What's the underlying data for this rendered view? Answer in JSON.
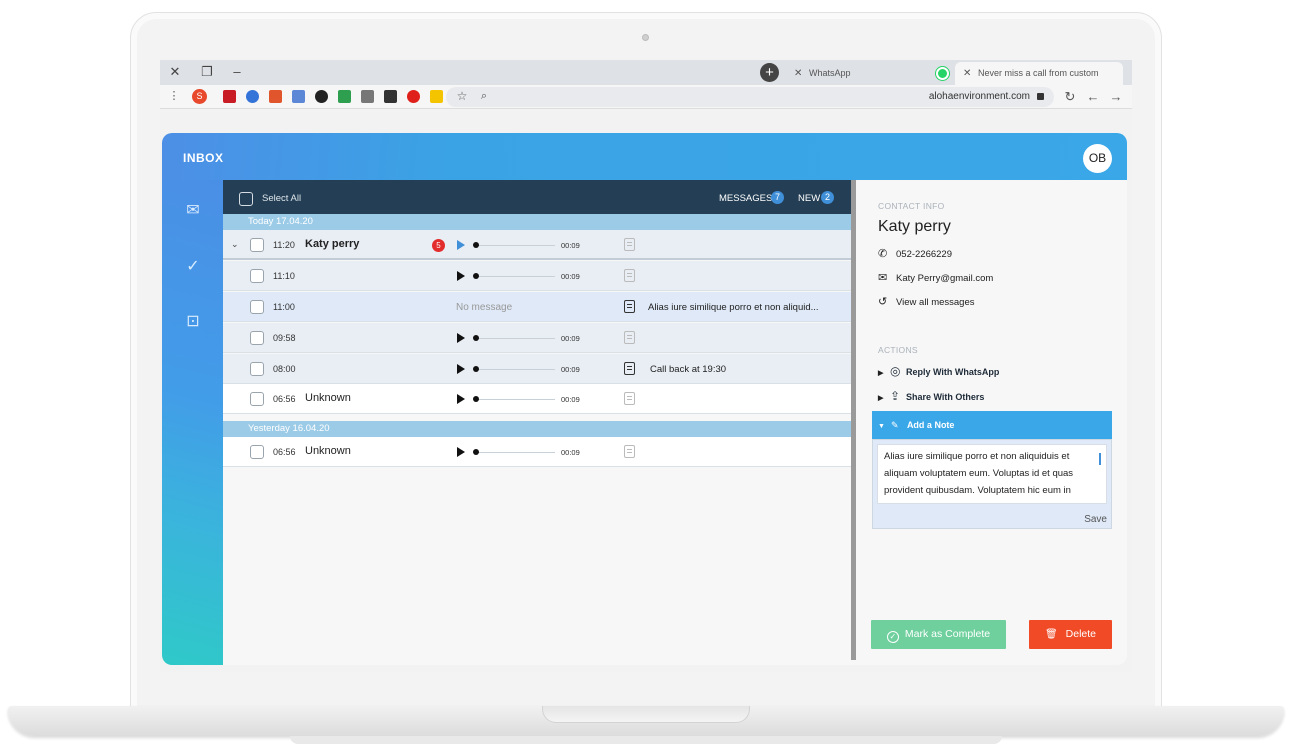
{
  "browser": {
    "tabs": [
      {
        "title": "WhatsApp"
      },
      {
        "title": "Never miss a call from customers"
      }
    ],
    "url": "alohaenvironment.com",
    "extension_badge": "S"
  },
  "app": {
    "title": "INBOX",
    "avatar_initials": "OB",
    "colors": {
      "header": "#3aa7e8",
      "list_header": "#243f55",
      "complete": "#6fd09e",
      "delete": "#f04a26",
      "badge_red": "#e32d2d"
    }
  },
  "list": {
    "select_all": "Select All",
    "messages_label": "MESSAGES",
    "messages_count": "7",
    "new_label": "NEW",
    "new_count": "2",
    "groups": [
      {
        "date": "Today 17.04.20",
        "rows": [
          {
            "time": "11:20",
            "name": "Katy perry",
            "count": "5",
            "duration": "00:09",
            "note": ""
          },
          {
            "time": "11:10",
            "name": "",
            "duration": "00:09",
            "note": ""
          },
          {
            "time": "11:00",
            "name": "",
            "no_message": "No message",
            "note": "Alias iure similique porro et non aliquid..."
          },
          {
            "time": "09:58",
            "name": "",
            "duration": "00:09",
            "note": ""
          },
          {
            "time": "08:00",
            "name": "",
            "duration": "00:09",
            "note": "Call back at 19:30"
          },
          {
            "time": "06:56",
            "name": "Unknown",
            "duration": "00:09",
            "note": ""
          }
        ]
      },
      {
        "date": "Yesterday 16.04.20",
        "rows": [
          {
            "time": "06:56",
            "name": "Unknown",
            "duration": "00:09",
            "note": ""
          }
        ]
      }
    ]
  },
  "contact": {
    "section_label": "CONTACT INFO",
    "name": "Katy perry",
    "phone": "052-2266229",
    "email": "Katy Perry@gmail.com",
    "view_all": "View all messages",
    "actions_label": "ACTIONS",
    "reply_whatsapp": "Reply With WhatsApp",
    "share_others": "Share With Others",
    "add_note": "Add a Note",
    "note_text": "Alias iure similique porro et non aliquiduis et aliquam  voluptatem eum. Voluptas id et quas provident quibusdam. Voluptatem hic eum in quaerat beatae fugit perferendis enim soluta. Quae officiis facere",
    "save": "Save",
    "mark_complete": "Mark as Complete",
    "delete": "Delete"
  }
}
